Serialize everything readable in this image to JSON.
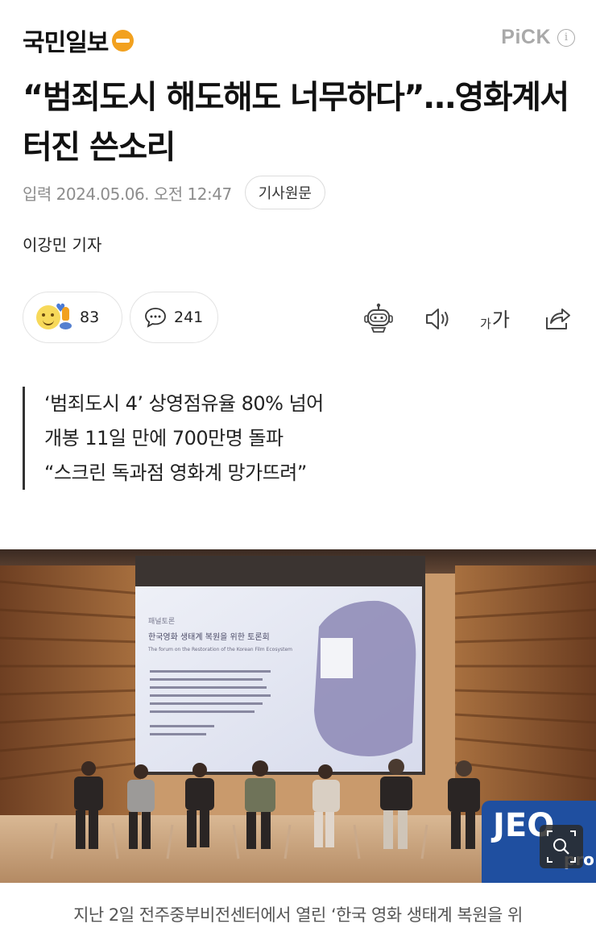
{
  "header": {
    "logo_text": "국민일보",
    "logo_icon": "kmib-logo-mark",
    "pick_label": "PiCK",
    "info_icon": "info-icon"
  },
  "article": {
    "headline": "“범죄도시 해도해도 너무하다”…영화계서 터진 쓴소리",
    "date_label": "입력",
    "date_value": "2024.05.06. 오전 12:47",
    "source_button": "기사원문",
    "reporter": "이강민 기자"
  },
  "actions": {
    "reaction_count": "83",
    "comment_count": "241",
    "font_size_label_small": "가",
    "font_size_label_large": "가",
    "icons": [
      "reaction-emoji-icon",
      "comment-icon",
      "summary-bot-icon",
      "speaker-icon",
      "font-size-icon",
      "share-icon"
    ]
  },
  "subheads": [
    "‘범죄도시 4’ 상영점유율 80% 넘어",
    "개봉 11일 만에 700만명 돌파",
    "“스크린 독과점 영화계 망가뜨려”"
  ],
  "photo": {
    "screen_heading": "한국영화 생태계 복원을 위한 토론회",
    "screen_label": "패널토론",
    "screen_subtitle": "The forum on the Restoration of the Korean Film Ecosystem",
    "banner_text": "JEO",
    "banner_sub": "pro",
    "zoom_icon": "zoom-icon"
  },
  "caption": "지난 2일 전주중부비전센터에서 열린 ‘한국 영화 생태계 복원을 위",
  "colors": {
    "accent": "#f2a11f",
    "muted": "#8d8d8d",
    "pick": "#a9a9a9"
  }
}
